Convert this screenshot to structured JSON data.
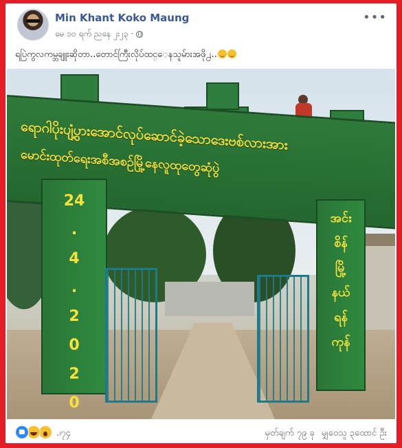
{
  "post": {
    "author": "Min Khant Koko Maung",
    "timestamp": "မေ ၁၀ ရက် ညနေ ၂း၂၃ ·",
    "privacy_icon": "globe-icon",
    "text": "ရပြဲကွလကမ္ဘချူးဆိုတာ..တောင်ကြီးလိုပ်ထင္ေနသူမ်ားအဖို႕..",
    "emojis": [
      "smile-emoji",
      "smile-emoji"
    ]
  },
  "photo": {
    "banner_line_1": "ရောဂါပိုးပျံ့ပွားအောင်လုပ်ဆောင်ခဲ့သောဒေးဗစ်လားအား",
    "banner_line_2": "မောင်းထုတ်ရေးအစီအစဉ်မြို့နေလူထုတွေဆုံပွဲ",
    "left_pillar": "24\n.\n4\n.\n2\n0\n2\n0",
    "right_pillar": "အင်း\nစိန်\nမြို့\nနယ်\nရန်\nကုန်"
  },
  "footer": {
    "reaction_icons": [
      "like-icon",
      "haha-icon",
      "wow-icon"
    ],
    "reaction_count": ".၊၇၄",
    "comments": "မှတ်ချက် ၇၉ ခု",
    "shares": "မျှဝေသူ ၃ထောင် ဦး"
  },
  "colors": {
    "frame": "#e41e26",
    "author_link": "#385898",
    "banner_green": "#2f7a3a",
    "banner_text": "#f5e23a",
    "like_blue": "#2d88ff"
  }
}
